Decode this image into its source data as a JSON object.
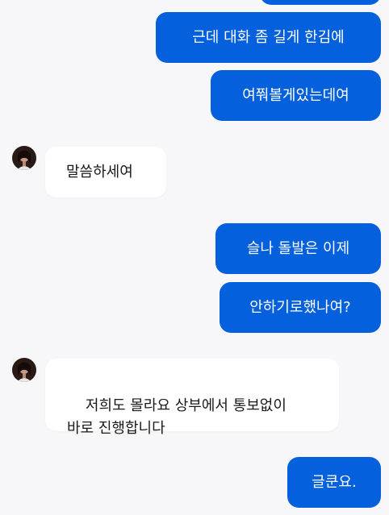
{
  "colors": {
    "background": "#f7f6f8",
    "outgoing_bubble": "#0460dd",
    "incoming_bubble": "#ffffff"
  },
  "messages": [
    {
      "from": "me",
      "text": ""
    },
    {
      "from": "me",
      "text": "근데 대화 좀 길게 한김에"
    },
    {
      "from": "me",
      "text": "여쭤볼게있는데여"
    },
    {
      "from": "other",
      "text": "말씀하세여"
    },
    {
      "from": "me",
      "text": "슬나 돌발은 이제"
    },
    {
      "from": "me",
      "text": "안하기로했나여?"
    },
    {
      "from": "other",
      "text": "저희도 몰라요 상부에서 통보없이\n바로 진행합니다"
    },
    {
      "from": "me",
      "text": "글쿤요."
    }
  ]
}
